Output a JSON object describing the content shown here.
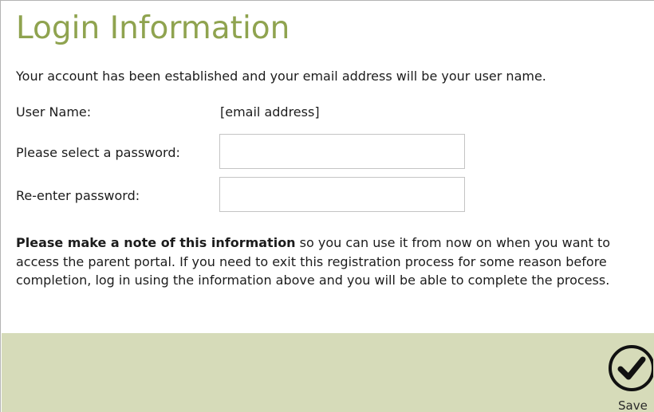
{
  "form": {
    "title": "Login Information",
    "intro": "Your account has been established and your email address will be your user name.",
    "username_label": "User Name:",
    "username_value": "[email address]",
    "password_label": "Please select a password:",
    "password_value": "",
    "confirm_label": "Re-enter password:",
    "confirm_value": ""
  },
  "note": {
    "bold": "Please make a note of this information",
    "text": " so you can use it from now on when you want to access the parent portal.  If you need to exit this registration process for some reason before completion, log in using the information above and you will be able to complete the process."
  },
  "footer": {
    "save_label": "Save",
    "save_icon": "check-circle-icon",
    "background_color": "#d6dbb9"
  },
  "colors": {
    "title": "#8fa34f"
  }
}
